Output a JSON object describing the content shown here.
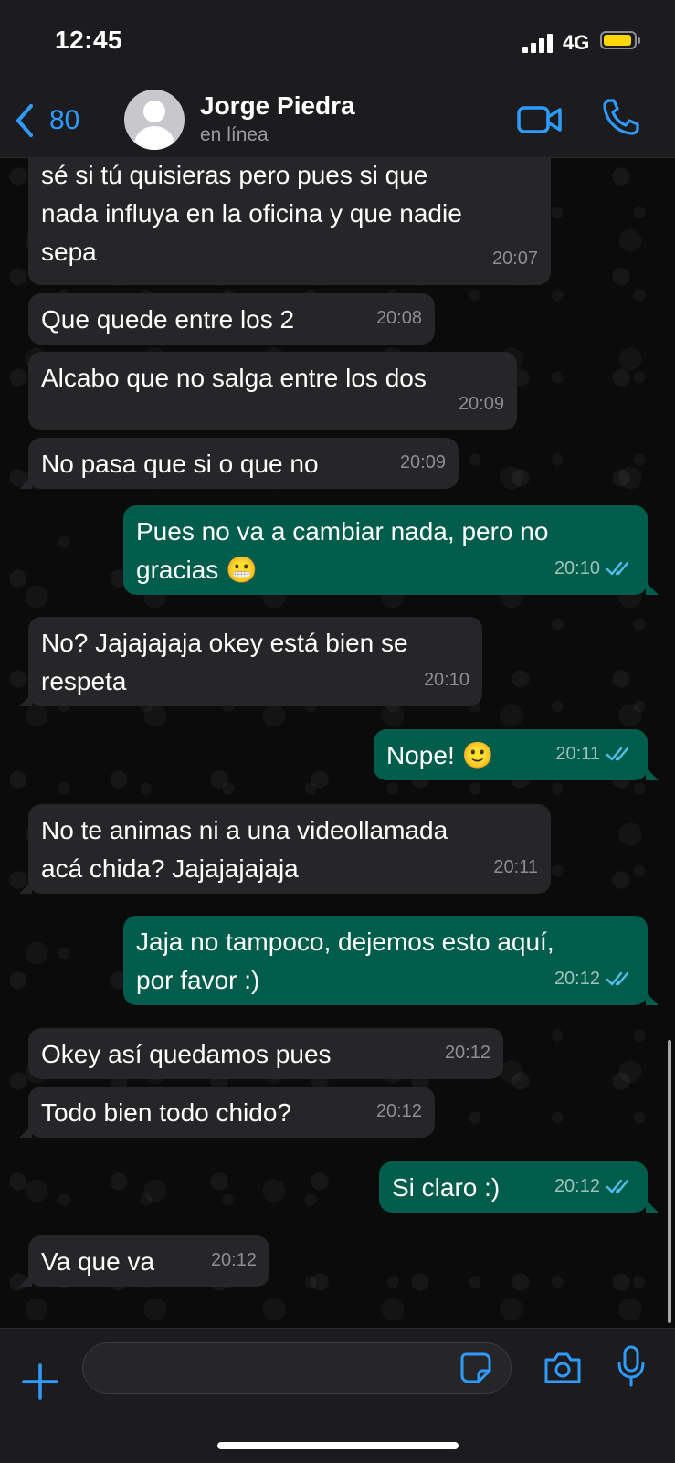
{
  "status_bar": {
    "time": "12:45",
    "network": "4G"
  },
  "header": {
    "back_count": "80",
    "contact_name": "Jorge Piedra",
    "contact_status": "en línea"
  },
  "messages": [
    {
      "dir": "in",
      "text": "sé si tú quisieras pero pues si que\nnada influya en la oficina y que nadie\nsepa",
      "time": "20:07"
    },
    {
      "dir": "in",
      "text": "Que quede entre los 2",
      "time": "20:08"
    },
    {
      "dir": "in",
      "text": "Alcabo que no salga entre los dos",
      "time": "20:09"
    },
    {
      "dir": "in",
      "text": "No pasa que si o que no",
      "time": "20:09"
    },
    {
      "dir": "out",
      "text": "Pues no va a cambiar nada, pero no\ngracias 😬",
      "time": "20:10"
    },
    {
      "dir": "in",
      "text": "No? Jajajajaja okey está bien se\nrespeta",
      "time": "20:10"
    },
    {
      "dir": "out",
      "text": "Nope! 🙂",
      "time": "20:11"
    },
    {
      "dir": "in",
      "text": "No te animas ni a una videollamada\nacá chida? Jajajajajaja",
      "time": "20:11"
    },
    {
      "dir": "out",
      "text": "Jaja no tampoco, dejemos esto aquí,\npor favor :)",
      "time": "20:12"
    },
    {
      "dir": "in",
      "text": "Okey así quedamos pues",
      "time": "20:12"
    },
    {
      "dir": "in",
      "text": "Todo bien todo chido?",
      "time": "20:12"
    },
    {
      "dir": "out",
      "text": "Si claro :)",
      "time": "20:12"
    },
    {
      "dir": "in",
      "text": "Va que va",
      "time": "20:12"
    }
  ],
  "composer": {
    "placeholder": ""
  },
  "colors": {
    "accent": "#2f9bff",
    "incoming": "#262628",
    "outgoing": "#005c4b",
    "battery": "#ffd60a"
  }
}
